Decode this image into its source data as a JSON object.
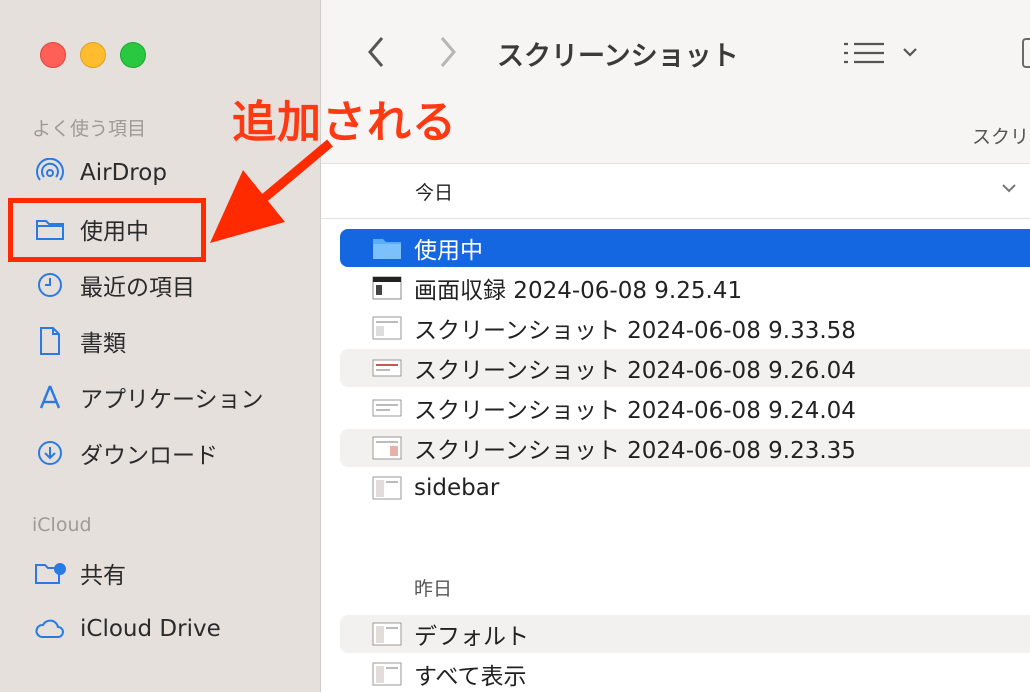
{
  "sidebar": {
    "favorites_label": "よく使う項目",
    "icloud_label": "iCloud",
    "items": [
      {
        "label": "AirDrop",
        "icon": "airdrop-icon"
      },
      {
        "label": "使用中",
        "icon": "folder-icon"
      },
      {
        "label": "最近の項目",
        "icon": "clock-icon"
      },
      {
        "label": "書類",
        "icon": "document-icon"
      },
      {
        "label": "アプリケーション",
        "icon": "applications-icon"
      },
      {
        "label": "ダウンロード",
        "icon": "download-icon"
      }
    ],
    "icloud_items": [
      {
        "label": "共有",
        "icon": "shared-folder-icon"
      },
      {
        "label": "iCloud Drive",
        "icon": "cloud-icon"
      }
    ]
  },
  "annotation": {
    "text": "追加される",
    "color": "#ff3a12"
  },
  "toolbar": {
    "title": "スクリーンショット",
    "path_crumb": "スクリ"
  },
  "group_today": {
    "label": "今日"
  },
  "group_yesterday": {
    "label": "昨日"
  },
  "files_today": [
    {
      "name": "使用中",
      "kind": "folder",
      "selected": true
    },
    {
      "name": "画面収録 2024-06-08 9.25.41",
      "kind": "video"
    },
    {
      "name": "スクリーンショット 2024-06-08 9.33.58",
      "kind": "image"
    },
    {
      "name": "スクリーンショット 2024-06-08 9.26.04",
      "kind": "image"
    },
    {
      "name": "スクリーンショット 2024-06-08 9.24.04",
      "kind": "image"
    },
    {
      "name": "スクリーンショット 2024-06-08 9.23.35",
      "kind": "image"
    },
    {
      "name": "sidebar",
      "kind": "image"
    }
  ],
  "files_yesterday": [
    {
      "name": "デフォルト",
      "kind": "image"
    },
    {
      "name": "すべて表示",
      "kind": "image"
    }
  ],
  "colors": {
    "accent": "#1467e1",
    "sidebar_bg": "#e6e0dd",
    "icon_blue": "#2a7ae4"
  }
}
